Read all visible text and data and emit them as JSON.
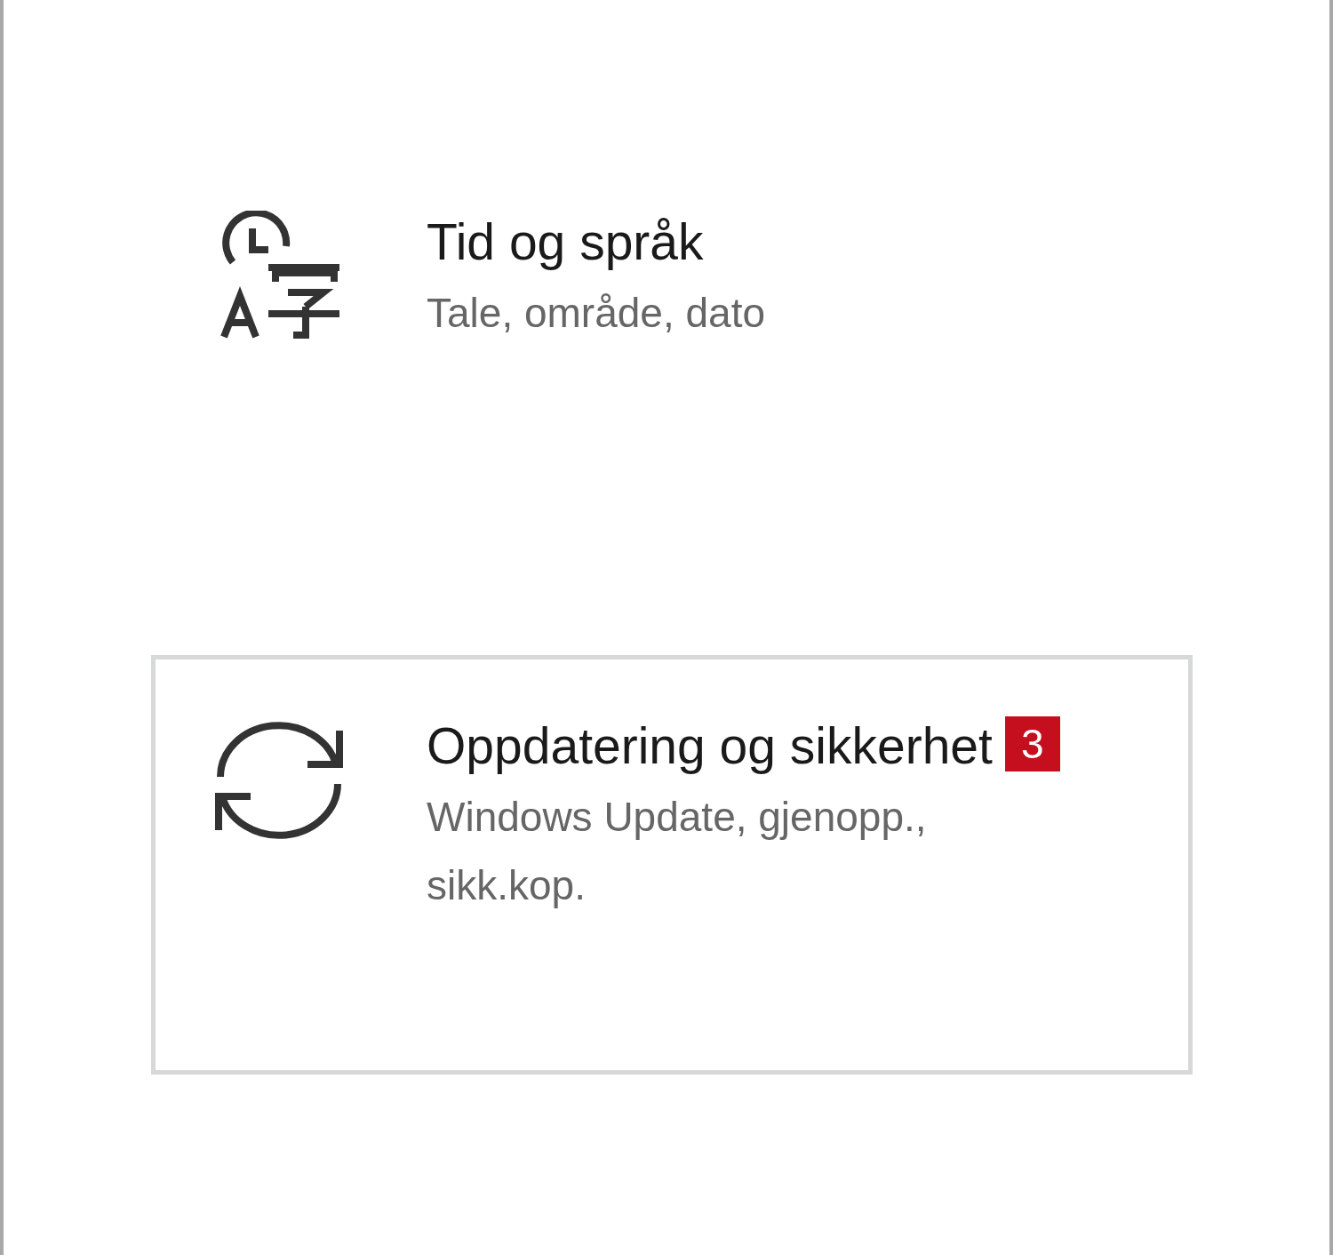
{
  "items": [
    {
      "title": "Tid og språk",
      "subtitle": "Tale, område, dato",
      "focused": false
    },
    {
      "title": "Oppdatering og sikkerhet",
      "badge": "3",
      "subtitle": "Windows Update, gjenopp., sikk.kop.",
      "focused": true
    }
  ]
}
